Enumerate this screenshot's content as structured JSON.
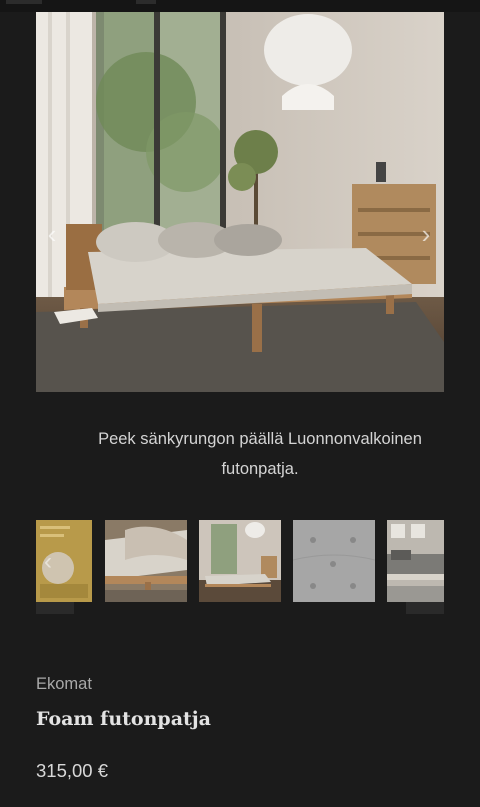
{
  "gallery": {
    "main_image_alt": "",
    "caption": "Peek sänkyrungon päällä Luonnonvalkoinen futonpatja.",
    "prev_icon": "chevron-left-icon",
    "next_icon": "chevron-right-icon"
  },
  "thumbnails": [
    {
      "name": "thumbnail-1",
      "color": "#b89a4a"
    },
    {
      "name": "thumbnail-2",
      "color": "#9c8c7a"
    },
    {
      "name": "thumbnail-3",
      "color": "#b5aa9b"
    },
    {
      "name": "thumbnail-4",
      "color": "#a6a6a6"
    },
    {
      "name": "thumbnail-5",
      "color": "#8a8a86"
    }
  ],
  "product": {
    "brand": "Ekomat",
    "title": "Foam futonpatja",
    "price": "315,00 €"
  },
  "colors": {
    "background": "#1b1b1b",
    "text": "#d8d8d8"
  }
}
